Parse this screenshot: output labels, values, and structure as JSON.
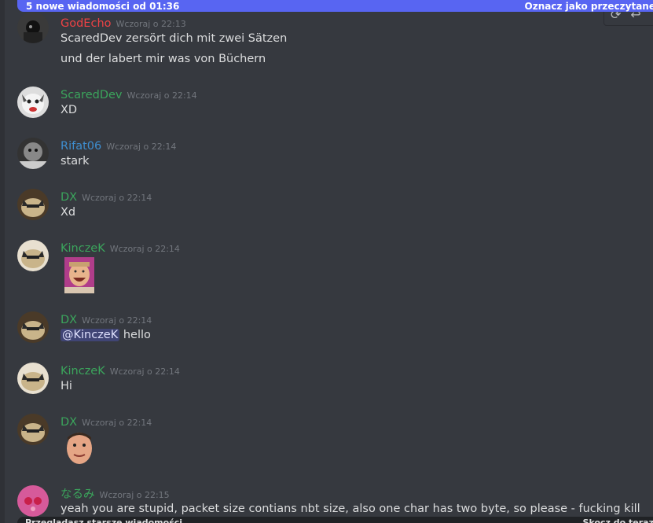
{
  "banner": {
    "new_messages": "5 nowe wiadomości od 01:36",
    "mark_read": "Oznacz jako przeczytane"
  },
  "colors": {
    "green_role": "#3ba55c",
    "blue_role": "#3e8ed0",
    "red_role": "#ed4245",
    "accent": "#5865f2"
  },
  "messages": [
    {
      "author": "GodEcho",
      "time": "Wczoraj o 22:13",
      "lines": [
        "ScaredDev zersört dich mit zwei Sätzen",
        "und der labert mir was von Büchern"
      ]
    },
    {
      "author": "ScaredDev",
      "time": "Wczoraj o 22:14",
      "text": "XD"
    },
    {
      "author": "Rifat06",
      "time": "Wczoraj o 22:14",
      "text": "stark"
    },
    {
      "author": "DX",
      "time": "Wczoraj o 22:14",
      "text": "Xd"
    },
    {
      "author": "KinczeK",
      "time": "Wczoraj o 22:14",
      "emoji": "laughing-man-emoji"
    },
    {
      "author": "DX",
      "time": "Wczoraj o 22:14",
      "mention": "@KinczeK",
      "text": "hello"
    },
    {
      "author": "KinczeK",
      "time": "Wczoraj o 22:14",
      "text": "Hi"
    },
    {
      "author": "DX",
      "time": "Wczoraj o 22:14",
      "emoji": "face-emoji"
    },
    {
      "author": "なるみ",
      "time": "Wczoraj o 22:15",
      "text": "yeah you are stupid, packet size contians nbt size, also one char has two byte, so please - fucking kill"
    }
  ],
  "bottom": {
    "left": "Przeglądasz starsze wiadomości",
    "right": "Skocz do teraz"
  }
}
